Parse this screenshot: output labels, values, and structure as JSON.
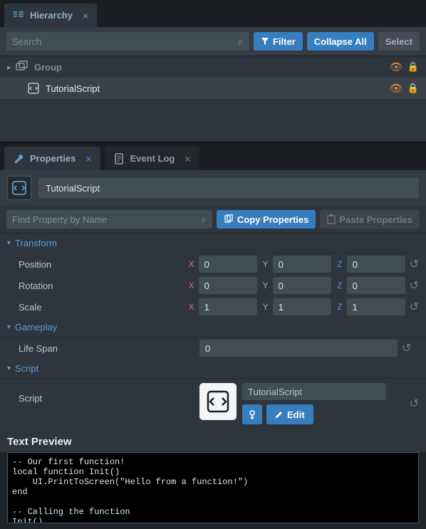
{
  "hierarchy_panel": {
    "tab_label": "Hierarchy",
    "search_placeholder": "Search",
    "filter_button": "Filter",
    "collapse_button": "Collapse All",
    "select_button": "Select",
    "tree": [
      {
        "label": "Group",
        "muted": true,
        "expandable": true,
        "visible_icon": true,
        "locked": true
      },
      {
        "label": "TutorialScript",
        "selected": true,
        "visible_icon": true,
        "locked": false
      }
    ]
  },
  "properties_panel": {
    "tabs": [
      {
        "label": "Properties",
        "active": true
      },
      {
        "label": "Event Log",
        "active": false
      }
    ],
    "object_name": "TutorialScript",
    "search_placeholder": "Find Property by Name",
    "copy_button": "Copy Properties",
    "paste_button": "Paste Properties",
    "sections": {
      "transform": {
        "title": "Transform",
        "rows": [
          {
            "label": "Position",
            "x": "0",
            "y": "0",
            "z": "0"
          },
          {
            "label": "Rotation",
            "x": "0",
            "y": "0",
            "z": "0"
          },
          {
            "label": "Scale",
            "x": "1",
            "y": "1",
            "z": "1"
          }
        ]
      },
      "gameplay": {
        "title": "Gameplay",
        "life_span_label": "Life Span",
        "life_span_value": "0"
      },
      "script": {
        "title": "Script",
        "field_label": "Script",
        "script_name": "TutorialScript",
        "edit_label": "Edit"
      }
    },
    "text_preview_label": "Text Preview",
    "code": "-- Our first function!\nlocal function Init()\n    UI.PrintToScreen(\"Hello from a function!\")\nend\n\n-- Calling the function\nInit()"
  }
}
